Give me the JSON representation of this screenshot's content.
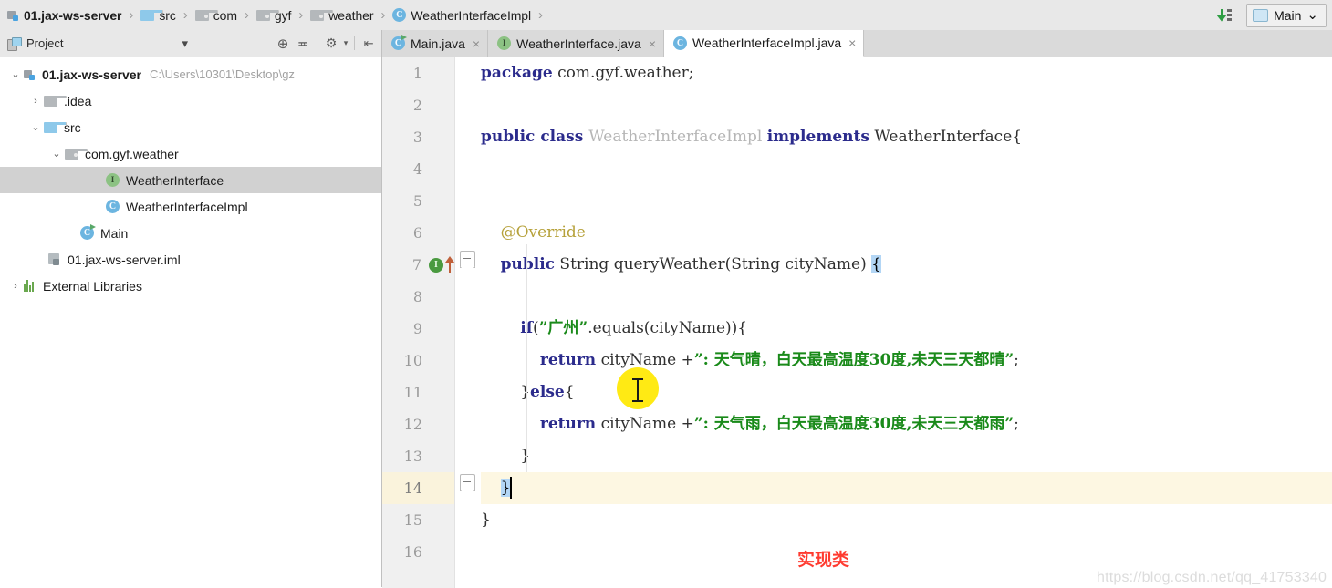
{
  "breadcrumb": {
    "items": [
      {
        "label": "01.jax-ws-server",
        "icon": "module-icon"
      },
      {
        "label": "src",
        "icon": "folder-icon"
      },
      {
        "label": "com",
        "icon": "package-folder-icon"
      },
      {
        "label": "gyf",
        "icon": "package-folder-icon"
      },
      {
        "label": "weather",
        "icon": "package-folder-icon"
      },
      {
        "label": "WeatherInterfaceImpl",
        "icon": "class-icon"
      }
    ],
    "separator": "›"
  },
  "toolbar": {
    "download_icon": "download-sort-icon",
    "run_config_label": "Main",
    "run_config_caret": "⌄"
  },
  "sidebar": {
    "title": "Project",
    "title_caret": "▾",
    "tools": [
      {
        "name": "locate-icon",
        "glyph": "⊕"
      },
      {
        "name": "collapse-all-icon",
        "glyph": "≖"
      },
      {
        "name": "settings-gear-icon",
        "glyph": "⚙"
      },
      {
        "name": "gear-caret-icon",
        "glyph": "▾"
      },
      {
        "name": "hide-panel-icon",
        "glyph": "⇥"
      }
    ],
    "tree": [
      {
        "arrow": "⌄",
        "icon": "module-icon",
        "label": "01.jax-ws-server",
        "bold": true,
        "path": "C:\\Users\\10301\\Desktop\\gz",
        "indent": 0,
        "selected": false
      },
      {
        "arrow": "›",
        "icon": "folder-gray-icon",
        "label": ".idea",
        "bold": false,
        "path": "",
        "indent": 1,
        "selected": false
      },
      {
        "arrow": "⌄",
        "icon": "folder-icon",
        "label": "src",
        "bold": false,
        "path": "",
        "indent": 1,
        "selected": false
      },
      {
        "arrow": "⌄",
        "icon": "package-folder-icon",
        "label": "com.gyf.weather",
        "bold": false,
        "path": "",
        "indent": 2,
        "selected": false
      },
      {
        "arrow": "",
        "icon": "interface-icon",
        "label": "WeatherInterface",
        "bold": false,
        "path": "",
        "indent": 3,
        "selected": true
      },
      {
        "arrow": "",
        "icon": "class-icon",
        "label": "WeatherInterfaceImpl",
        "bold": false,
        "path": "",
        "indent": 3,
        "selected": false
      },
      {
        "arrow": "",
        "icon": "class-runnable-icon",
        "label": "Main",
        "bold": false,
        "path": "",
        "indent": 2,
        "selected": false
      },
      {
        "arrow": "",
        "icon": "iml-file-icon",
        "label": "01.jax-ws-server.iml",
        "bold": false,
        "path": "",
        "indent": 1,
        "selected": false
      },
      {
        "arrow": "›",
        "icon": "library-icon",
        "label": "External Libraries",
        "bold": false,
        "path": "",
        "indent": 0,
        "selected": false
      }
    ]
  },
  "editor": {
    "tabs": [
      {
        "label": "Main.java",
        "icon": "class-runnable-icon",
        "active": false,
        "close": "×"
      },
      {
        "label": "WeatherInterface.java",
        "icon": "interface-icon",
        "active": false,
        "close": "×"
      },
      {
        "label": "WeatherInterfaceImpl.java",
        "icon": "class-icon",
        "active": true,
        "close": "×"
      }
    ],
    "line_numbers": [
      "1",
      "2",
      "3",
      "4",
      "5",
      "6",
      "7",
      "8",
      "9",
      "10",
      "11",
      "12",
      "13",
      "14",
      "15",
      "16"
    ],
    "current_line": 14,
    "code_lines": [
      {
        "n": 1,
        "tokens": [
          {
            "t": "package",
            "c": "kw"
          },
          {
            "t": " com.gyf.weather;",
            "c": "pl"
          }
        ]
      },
      {
        "n": 2,
        "tokens": []
      },
      {
        "n": 3,
        "tokens": [
          {
            "t": "public class ",
            "c": "kw"
          },
          {
            "t": "WeatherInterfaceImpl",
            "c": "gry"
          },
          {
            "t": " ",
            "c": "pl"
          },
          {
            "t": "implements",
            "c": "kw"
          },
          {
            "t": " WeatherInterface{",
            "c": "pl"
          }
        ]
      },
      {
        "n": 4,
        "tokens": []
      },
      {
        "n": 5,
        "tokens": []
      },
      {
        "n": 6,
        "tokens": [
          {
            "t": "    @Override",
            "c": "ann"
          }
        ]
      },
      {
        "n": 7,
        "tokens": [
          {
            "t": "    ",
            "c": "pl"
          },
          {
            "t": "public",
            "c": "kw"
          },
          {
            "t": " String queryWeather(String cityName) ",
            "c": "pl"
          },
          {
            "t": "{",
            "c": "brace-hl"
          }
        ]
      },
      {
        "n": 8,
        "tokens": []
      },
      {
        "n": 9,
        "tokens": [
          {
            "t": "        ",
            "c": "pl"
          },
          {
            "t": "if",
            "c": "kw"
          },
          {
            "t": "(",
            "c": "pl"
          },
          {
            "t": "”广州”",
            "c": "str"
          },
          {
            "t": ".equals(cityName)){",
            "c": "pl"
          }
        ]
      },
      {
        "n": 10,
        "tokens": [
          {
            "t": "            ",
            "c": "pl"
          },
          {
            "t": "return",
            "c": "kw"
          },
          {
            "t": " cityName +",
            "c": "pl"
          },
          {
            "t": "”: 天气晴，白天最高温度30度,未天三天都晴”",
            "c": "str"
          },
          {
            "t": ";",
            "c": "pl"
          }
        ]
      },
      {
        "n": 11,
        "tokens": [
          {
            "t": "        }",
            "c": "pl"
          },
          {
            "t": "else",
            "c": "kw"
          },
          {
            "t": "{",
            "c": "pl"
          }
        ]
      },
      {
        "n": 12,
        "tokens": [
          {
            "t": "            ",
            "c": "pl"
          },
          {
            "t": "return",
            "c": "kw"
          },
          {
            "t": " cityName +",
            "c": "pl"
          },
          {
            "t": "”: 天气雨，白天最高温度30度,未天三天都雨”",
            "c": "str"
          },
          {
            "t": ";",
            "c": "pl"
          }
        ]
      },
      {
        "n": 13,
        "tokens": [
          {
            "t": "        }",
            "c": "pl"
          }
        ]
      },
      {
        "n": 14,
        "tokens": [
          {
            "t": "    ",
            "c": "pl"
          },
          {
            "t": "}",
            "c": "brace-hl"
          }
        ]
      },
      {
        "n": 15,
        "tokens": [
          {
            "t": "}",
            "c": "pl"
          }
        ]
      },
      {
        "n": 16,
        "tokens": []
      }
    ],
    "gutter_markers": {
      "line7": {
        "icon": "implementing-method-icon",
        "glyph": "I",
        "arrow": "overrides-arrow-icon"
      },
      "line7_fold": "fold-collapse-icon",
      "line14_fold": "fold-collapse-icon"
    }
  },
  "annotations": {
    "red_note": "实现类",
    "watermark": "https://blog.csdn.net/qq_41753340"
  },
  "colors": {
    "keyword": "#2b2b8c",
    "string": "#1a8a1a",
    "annotation": "#b6a13a",
    "grayed_identifier": "#b6b6b6",
    "current_line_bg": "#fdf7e2",
    "brace_match_bg": "#b3d6f5",
    "selection_bg": "#d1d1d1",
    "note_red": "#ff3b30",
    "toolbar_bg": "#e8e8e8",
    "tabs_bg": "#dadada"
  }
}
